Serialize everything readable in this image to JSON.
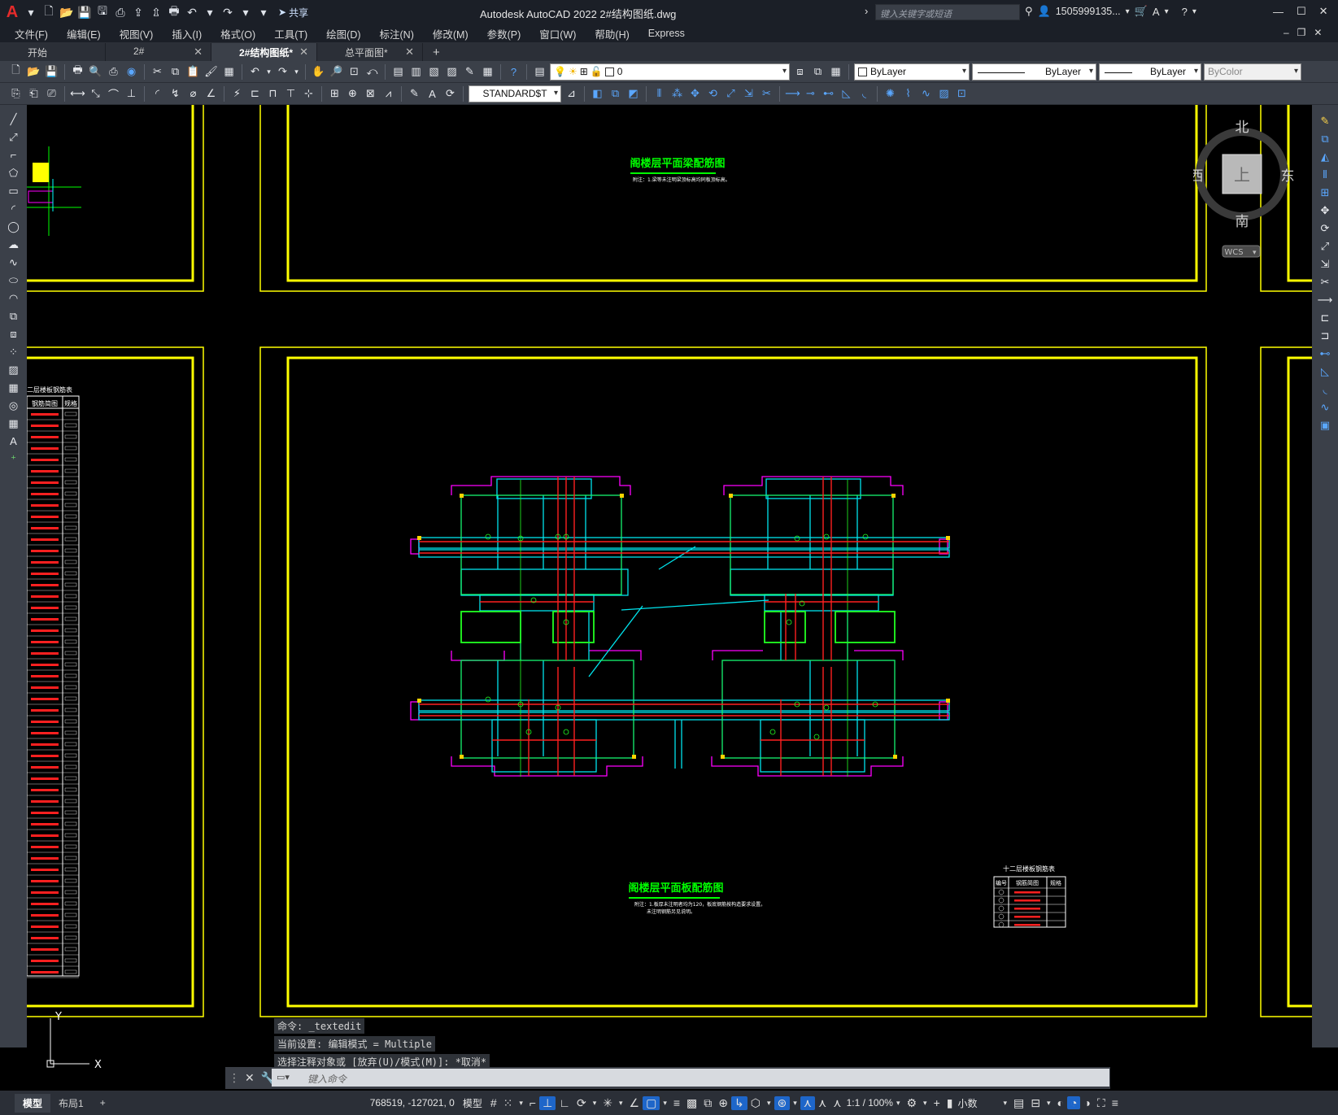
{
  "app": {
    "window_title": "Autodesk AutoCAD 2022    2#结构图纸.dwg",
    "share_label": "共享",
    "search_placeholder": "键入关键字或短语",
    "user": "1505999135...",
    "logo": "A"
  },
  "menu": [
    "文件(F)",
    "编辑(E)",
    "视图(V)",
    "插入(I)",
    "格式(O)",
    "工具(T)",
    "绘图(D)",
    "标注(N)",
    "修改(M)",
    "参数(P)",
    "窗口(W)",
    "帮助(H)",
    "Express"
  ],
  "doc_tabs": [
    {
      "label": "开始",
      "closable": false,
      "active": false
    },
    {
      "label": "2#",
      "closable": true,
      "active": false
    },
    {
      "label": "2#结构图纸*",
      "closable": true,
      "active": true
    },
    {
      "label": "总平面图*",
      "closable": true,
      "active": false
    }
  ],
  "toolbar": {
    "layer_value": "0",
    "color_value": "ByLayer",
    "linetype_value": "ByLayer",
    "lineweight_value": "ByLayer",
    "plotstyle_value": "ByColor",
    "textstyle_value": "STANDARD$T"
  },
  "viewcube": {
    "north": "北",
    "south": "南",
    "east": "东",
    "west": "西",
    "face": "上",
    "wcs": "WCS"
  },
  "ucs": {
    "y": "Y",
    "x": "X"
  },
  "drawing": {
    "title_top": "阁楼层平面梁配筋图",
    "note_top": "附注：1.梁等未注明梁顶标高均同板顶标高。",
    "title_bottom": "阁楼层平面板配筋图",
    "note_bottom_1": "附注：1.板厚未注明者均为120，板底钢筋按构造要求设置。",
    "note_bottom_2": "未注明钢筋另见说明。",
    "table_left_title": "二层楼板钢筋表",
    "table_left_h1": "钢筋简图",
    "table_left_h2": "规格",
    "table_right_title": "十二层楼板钢筋表",
    "table_right_h0": "编号",
    "table_right_h1": "钢筋简图",
    "table_right_h2": "规格"
  },
  "command": {
    "history": [
      "命令: _textedit",
      "当前设置: 编辑模式 = Multiple",
      "选择注释对象或 [放弃(U)/模式(M)]: *取消*"
    ],
    "placeholder": "键入命令"
  },
  "status": {
    "layout_tabs": [
      "模型",
      "布局1"
    ],
    "coords": "768519, -127021, 0",
    "model": "模型",
    "scale": "1:1 / 100%",
    "units": "小数"
  }
}
